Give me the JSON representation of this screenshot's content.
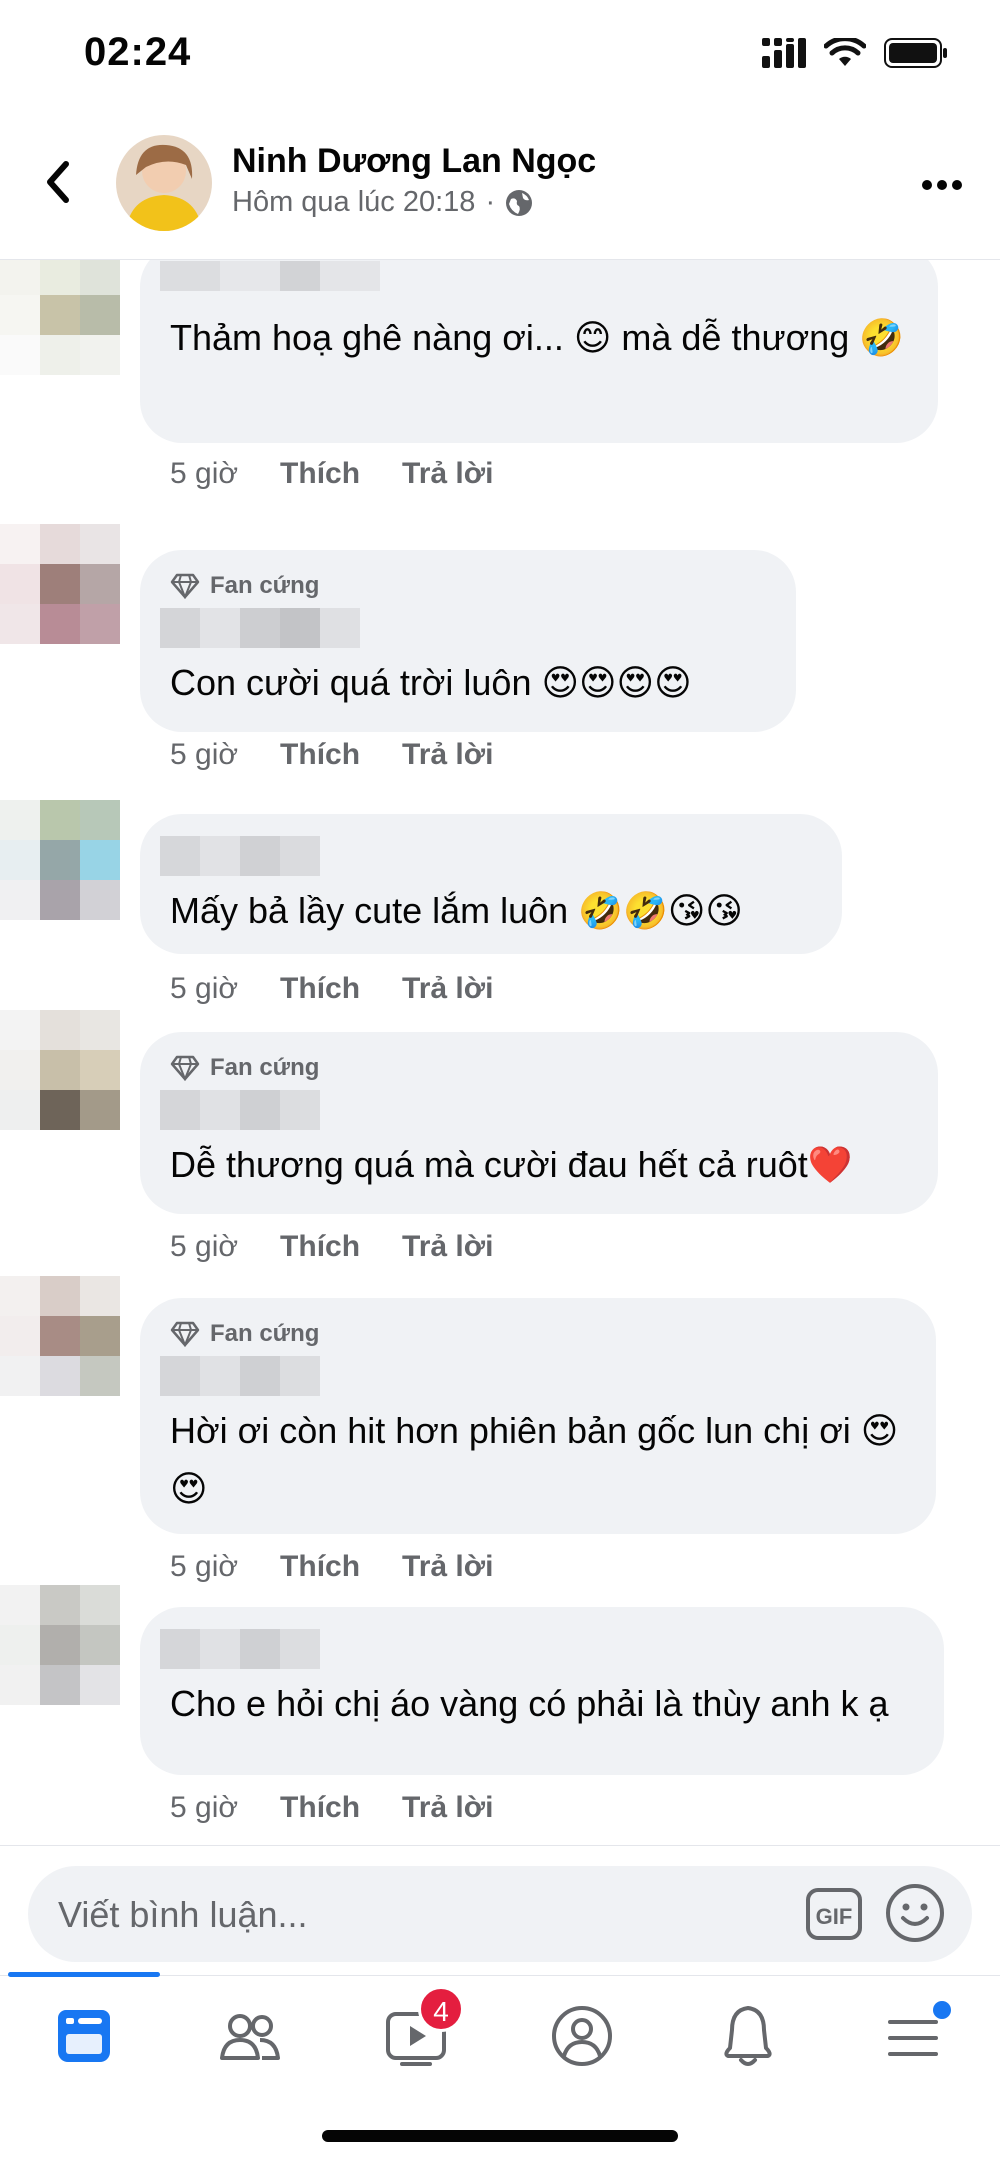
{
  "status_bar": {
    "time": "02:24"
  },
  "header": {
    "name": "Ninh Dương Lan Ngọc",
    "timestamp": "Hôm qua lúc 20:18",
    "separator": "·"
  },
  "comments": [
    {
      "badge": "",
      "text": "Thảm hoạ ghê nàng ơi... 😊 mà dễ thương 🤣",
      "time": "5 giờ",
      "like": "Thích",
      "reply": "Trả lời"
    },
    {
      "badge": "Fan cứng",
      "text": "Con cười quá trời luôn 😍😍😍😍",
      "time": "5 giờ",
      "like": "Thích",
      "reply": "Trả lời"
    },
    {
      "badge": "",
      "text": "Mấy bả lầy cute lắm luôn 🤣🤣😘😘",
      "time": "5 giờ",
      "like": "Thích",
      "reply": "Trả lời"
    },
    {
      "badge": "Fan cứng",
      "text": "Dễ thương quá mà cười đau hết cả ruôt❤️",
      "time": "5 giờ",
      "like": "Thích",
      "reply": "Trả lời"
    },
    {
      "badge": "Fan cứng",
      "text": "Hời ơi còn hit hơn phiên bản gốc lun chị ơi 😍😍",
      "time": "5 giờ",
      "like": "Thích",
      "reply": "Trả lời"
    },
    {
      "badge": "",
      "text": "Cho e hỏi chị áo vàng có phải là thùy anh k ạ",
      "time": "5 giờ",
      "like": "Thích",
      "reply": "Trả lời"
    }
  ],
  "composer": {
    "placeholder": "Viết bình luận...",
    "gif_label": "GIF"
  },
  "bottom_nav": {
    "items": [
      "home-feed-icon",
      "friends-icon",
      "watch-icon",
      "profile-icon",
      "notifications-icon",
      "menu-icon"
    ],
    "watch_badge": "4"
  },
  "colors": {
    "accent": "#1877f2",
    "bubble": "#f0f2f5",
    "badge_red": "#e41e3f",
    "meta_gray": "#65676b"
  }
}
